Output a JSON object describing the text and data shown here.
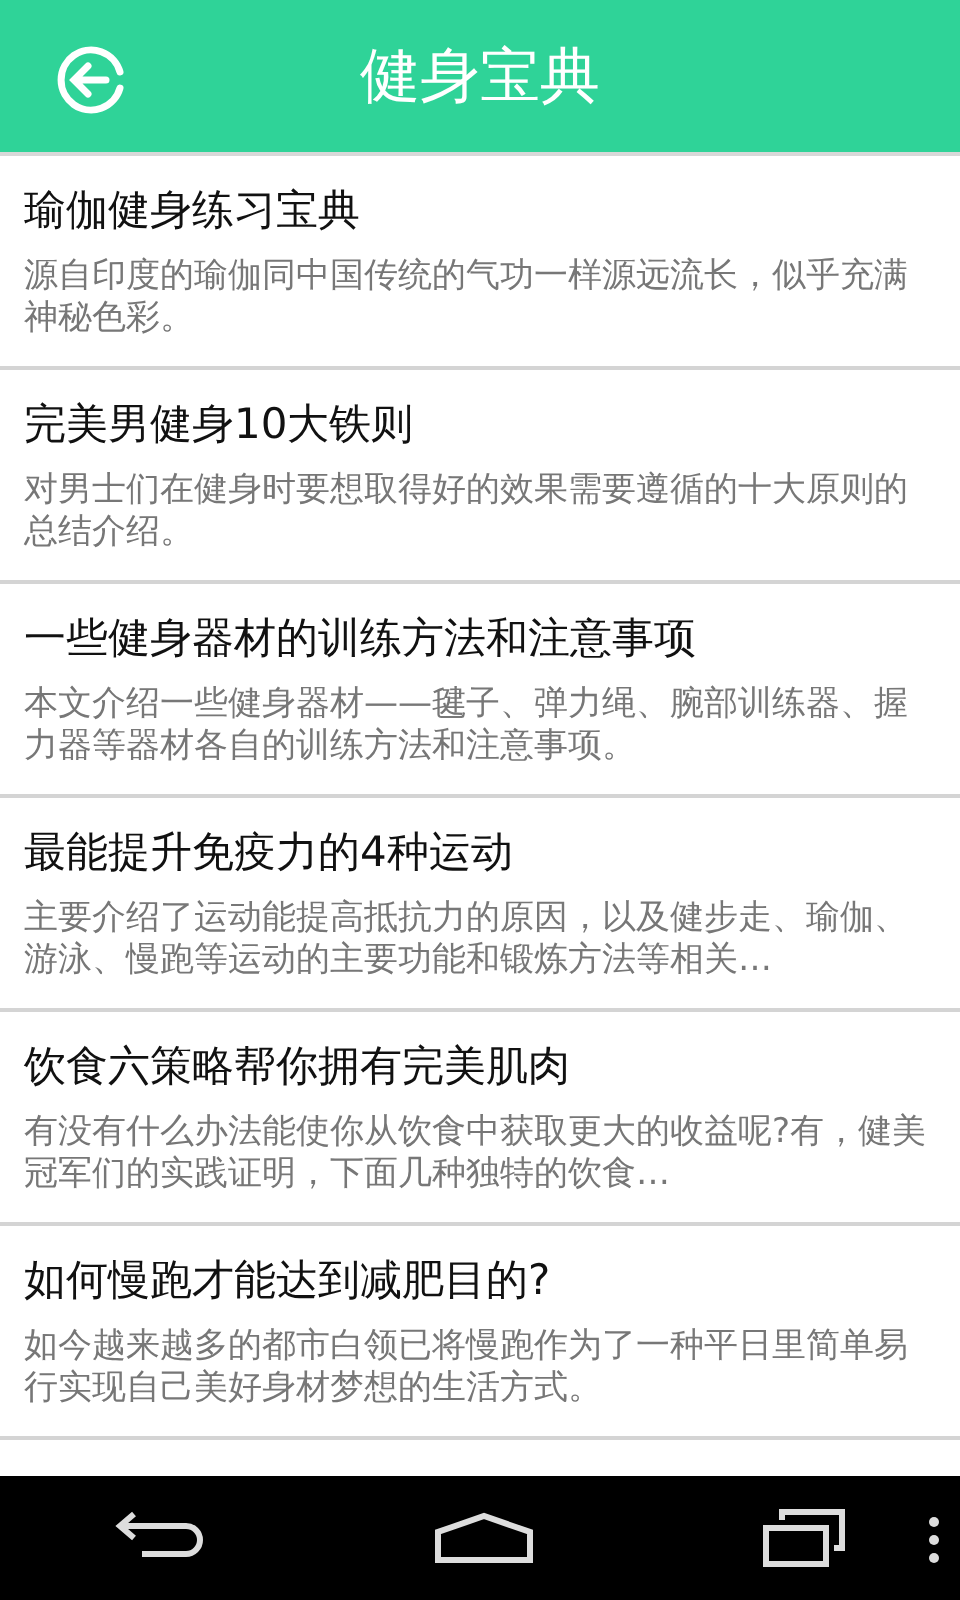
{
  "header": {
    "title": "健身宝典"
  },
  "articles": [
    {
      "title": "瑜伽健身练习宝典",
      "summary": "源自印度的瑜伽同中国传统的气功一样源远流长，似乎充满神秘色彩。"
    },
    {
      "title": "完美男健身10大铁则",
      "summary": "对男士们在健身时要想取得好的效果需要遵循的十大原则的总结介绍。"
    },
    {
      "title": "一些健身器材的训练方法和注意事项",
      "summary": "本文介绍一些健身器材——毽子、弹力绳、腕部训练器、握力器等器材各自的训练方法和注意事项。"
    },
    {
      "title": "最能提升免疫力的4种运动",
      "summary": "主要介绍了运动能提高抵抗力的原因，以及健步走、瑜伽、游泳、慢跑等运动的主要功能和锻炼方法等相关…"
    },
    {
      "title": "饮食六策略帮你拥有完美肌肉",
      "summary": "有没有什么办法能使你从饮食中获取更大的收益呢?有，健美冠军们的实践证明，下面几种独特的饮食…"
    },
    {
      "title": "如何慢跑才能达到减肥目的?",
      "summary": "如今越来越多的都市白领已将慢跑作为了一种平日里简单易行实现自己美好身材梦想的生活方式。"
    }
  ]
}
